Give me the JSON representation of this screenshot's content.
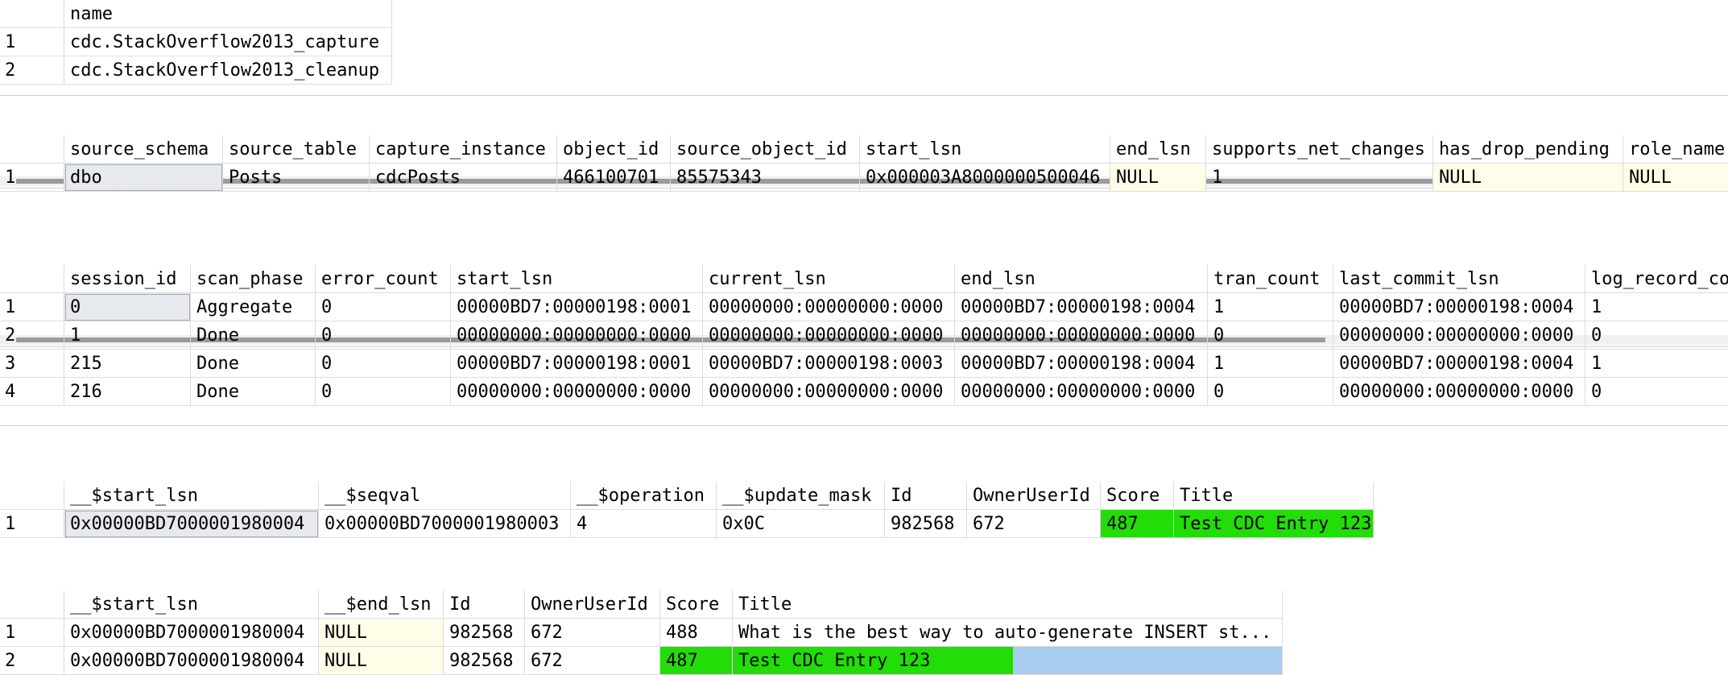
{
  "grid1": {
    "columns": [
      "name"
    ],
    "rows": [
      {
        "rownum": "1",
        "cells": [
          "cdc.StackOverflow2013_capture"
        ]
      },
      {
        "rownum": "2",
        "cells": [
          "cdc.StackOverflow2013_cleanup"
        ]
      }
    ]
  },
  "grid2": {
    "columns": [
      "source_schema",
      "source_table",
      "capture_instance",
      "object_id",
      "source_object_id",
      "start_lsn",
      "end_lsn",
      "supports_net_changes",
      "has_drop_pending",
      "role_name"
    ],
    "rows": [
      {
        "rownum": "1",
        "cells": [
          "dbo",
          "Posts",
          "cdcPosts",
          "466100701",
          "85575343",
          "0x000003A8000000500046",
          "NULL",
          "1",
          "NULL",
          "NULL"
        ]
      }
    ]
  },
  "grid3": {
    "columns": [
      "session_id",
      "scan_phase",
      "error_count",
      "start_lsn",
      "current_lsn",
      "end_lsn",
      "tran_count",
      "last_commit_lsn",
      "log_record_co"
    ],
    "rows": [
      {
        "rownum": "1",
        "cells": [
          "0",
          "Aggregate",
          "0",
          "00000BD7:00000198:0001",
          "00000000:00000000:0000",
          "00000BD7:00000198:0004",
          "1",
          "00000BD7:00000198:0004",
          "1"
        ]
      },
      {
        "rownum": "2",
        "cells": [
          "1",
          "Done",
          "0",
          "00000000:00000000:0000",
          "00000000:00000000:0000",
          "00000000:00000000:0000",
          "0",
          "00000000:00000000:0000",
          "0"
        ]
      },
      {
        "rownum": "3",
        "cells": [
          "215",
          "Done",
          "0",
          "00000BD7:00000198:0001",
          "00000BD7:00000198:0003",
          "00000BD7:00000198:0004",
          "1",
          "00000BD7:00000198:0004",
          "1"
        ]
      },
      {
        "rownum": "4",
        "cells": [
          "216",
          "Done",
          "0",
          "00000000:00000000:0000",
          "00000000:00000000:0000",
          "00000000:00000000:0000",
          "0",
          "00000000:00000000:0000",
          "0"
        ]
      }
    ]
  },
  "grid4": {
    "columns": [
      "__$start_lsn",
      "__$seqval",
      "__$operation",
      "__$update_mask",
      "Id",
      "OwnerUserId",
      "Score",
      "Title"
    ],
    "rows": [
      {
        "rownum": "1",
        "cells": [
          "0x00000BD7000001980004",
          "0x00000BD7000001980003",
          "4",
          "0x0C",
          "982568",
          "672",
          "487",
          "Test CDC Entry 123"
        ]
      }
    ]
  },
  "grid5": {
    "columns": [
      "__$start_lsn",
      "__$end_lsn",
      "Id",
      "OwnerUserId",
      "Score",
      "Title"
    ],
    "rows": [
      {
        "rownum": "1",
        "cells": [
          "0x00000BD7000001980004",
          "NULL",
          "982568",
          "672",
          "488",
          "What is the best way to auto-generate INSERT st..."
        ]
      },
      {
        "rownum": "2",
        "cells": [
          "0x00000BD7000001980004",
          "NULL",
          "982568",
          "672",
          "487",
          "Test CDC Entry 123"
        ]
      }
    ]
  },
  "colors": {
    "null_cell": "#fffce8",
    "highlight_green": "#22dd08",
    "selection_blue": "#a8cdf0",
    "grid_line": "#dcdcdc"
  }
}
